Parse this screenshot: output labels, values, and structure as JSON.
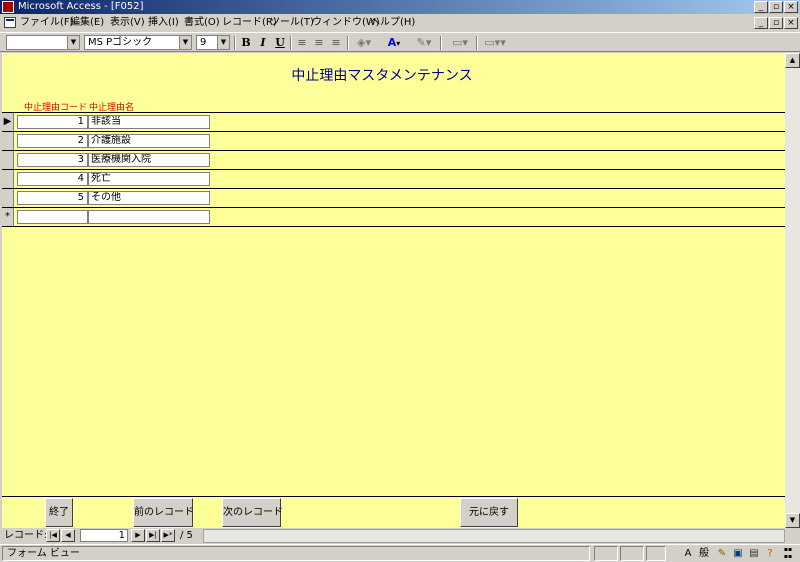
{
  "window": {
    "title": "Microsoft Access - [F052]",
    "controls": [
      "_",
      "▫",
      "×"
    ]
  },
  "menubar": {
    "items": [
      "ファイル(F)",
      "編集(E)",
      "表示(V)",
      "挿入(I)",
      "書式(O)",
      "レコード(R)",
      "ツール(T)",
      "ウィンドウ(W)",
      "ヘルプ(H)"
    ]
  },
  "toolbar": {
    "object_combo": "",
    "font_combo": "MS Pゴシック",
    "size_combo": "9",
    "bold": "B",
    "italic": "I",
    "underline": "U"
  },
  "form": {
    "title": "中止理由マスタメンテナンス",
    "columns": {
      "code": "中止理由コード",
      "name": "中止理由名"
    },
    "rows": [
      {
        "selector": "▶",
        "code": "1",
        "name": "非該当"
      },
      {
        "selector": "",
        "code": "2",
        "name": "介護施設"
      },
      {
        "selector": "",
        "code": "3",
        "name": "医療機関入院"
      },
      {
        "selector": "",
        "code": "4",
        "name": "死亡"
      },
      {
        "selector": "",
        "code": "5",
        "name": "その他"
      },
      {
        "selector": "*",
        "code": "",
        "name": ""
      }
    ],
    "buttons": {
      "close": "終了",
      "prev": "前のレコード",
      "next": "次のレコード",
      "undo": "元に戻す"
    },
    "background_color": "#ffff99",
    "title_color": "#00008b",
    "header_color": "#e00000"
  },
  "navigator": {
    "label": "レコード:",
    "current": "1",
    "total": "/ 5"
  },
  "status": {
    "text": "フォーム ビュー",
    "ime_labels": [
      "A",
      "般"
    ]
  }
}
